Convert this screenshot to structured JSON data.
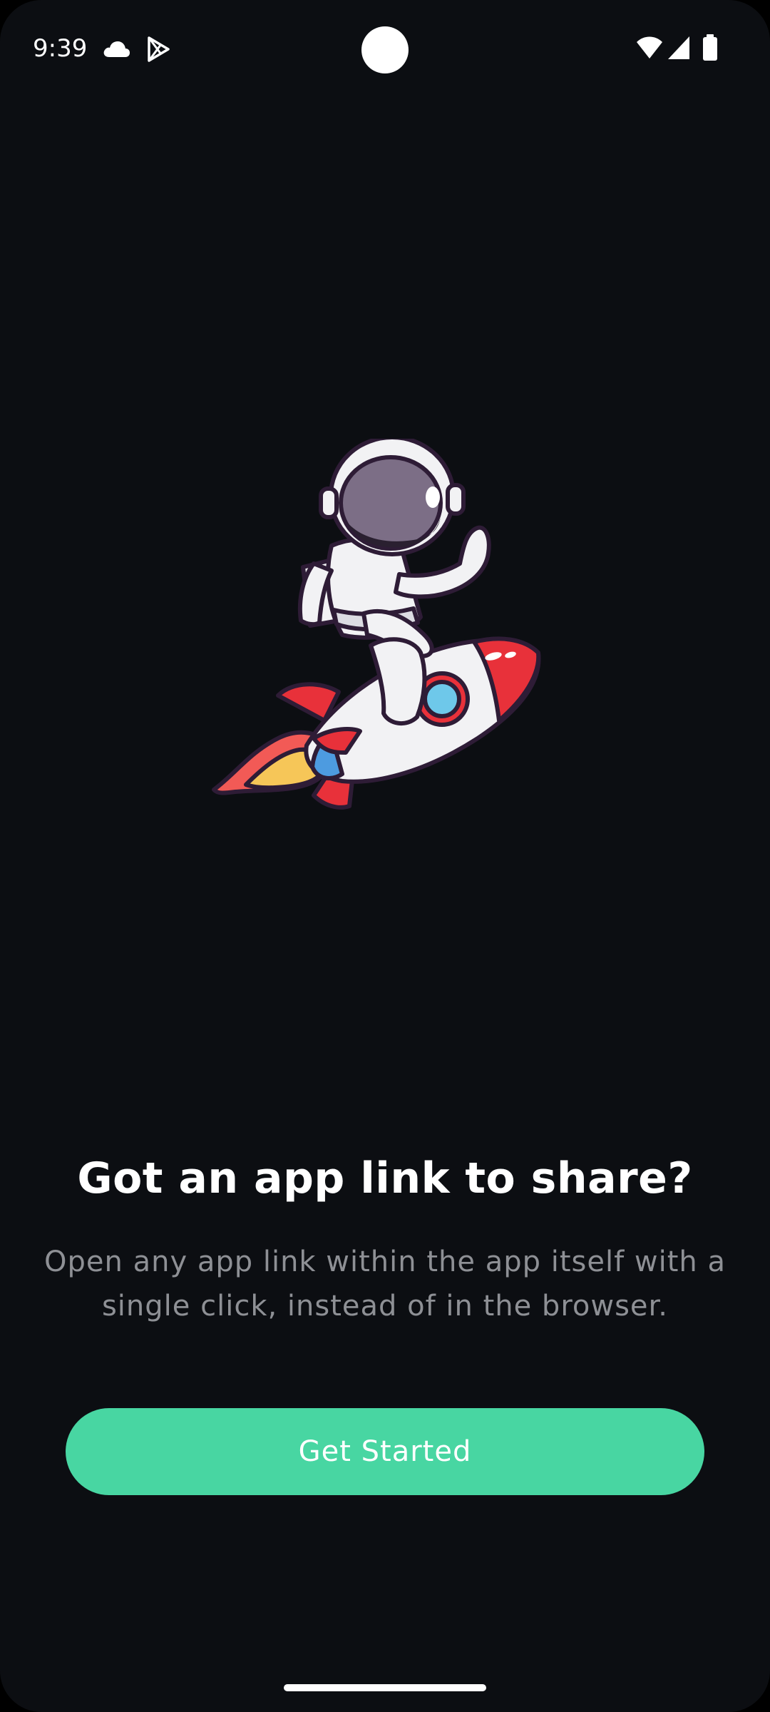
{
  "status_bar": {
    "time": "9:39",
    "left_icons": [
      "cloud-icon",
      "play-store-icon"
    ],
    "right_icons": [
      "wifi-icon",
      "cellular-signal-icon",
      "battery-icon"
    ]
  },
  "onboarding": {
    "illustration": "astronaut-riding-rocket",
    "title": "Got an app link to share?",
    "description": "Open any app link within the app itself with a single click, instead of in the browser.",
    "cta_label": "Get Started"
  },
  "colors": {
    "background": "#0c0e12",
    "accent": "#48d6a2",
    "title_text": "#ffffff",
    "body_text": "#8e9095"
  }
}
